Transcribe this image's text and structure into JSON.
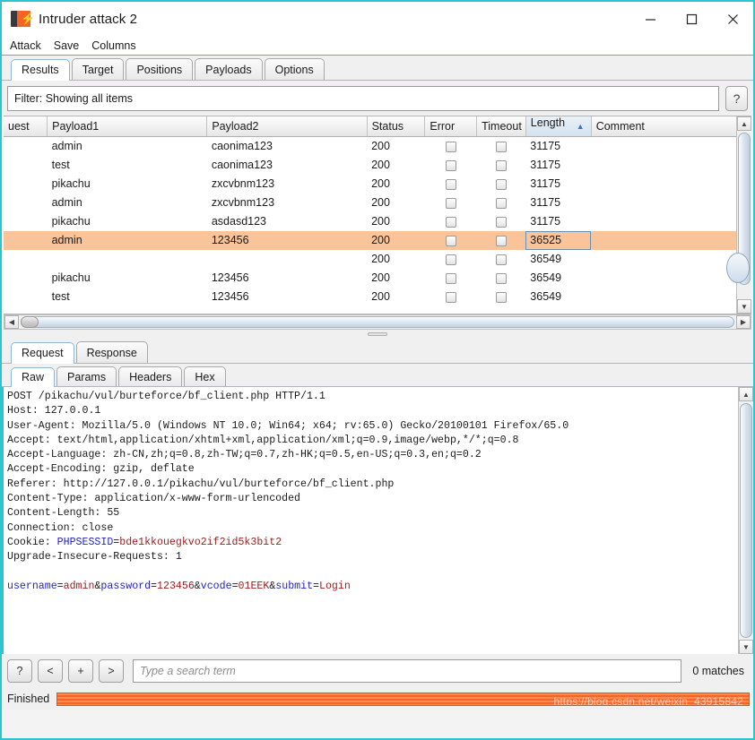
{
  "window": {
    "title": "Intruder attack 2",
    "icon": "burp-suite-icon",
    "minimize": "—",
    "maximize": "□",
    "close": "✕"
  },
  "menubar": {
    "items": [
      {
        "label": "Attack"
      },
      {
        "label": "Save"
      },
      {
        "label": "Columns"
      }
    ]
  },
  "main_tabs": [
    {
      "label": "Results",
      "active": true
    },
    {
      "label": "Target",
      "active": false
    },
    {
      "label": "Positions",
      "active": false
    },
    {
      "label": "Payloads",
      "active": false
    },
    {
      "label": "Options",
      "active": false
    }
  ],
  "filter": {
    "text": "Filter: Showing all items",
    "help_label": "?"
  },
  "results_table": {
    "columns": [
      {
        "label": "uest",
        "sorted": false
      },
      {
        "label": "Payload1",
        "sorted": false
      },
      {
        "label": "Payload2",
        "sorted": false
      },
      {
        "label": "Status",
        "sorted": false
      },
      {
        "label": "Error",
        "sorted": false
      },
      {
        "label": "Timeout",
        "sorted": false
      },
      {
        "label": "Length",
        "sorted": true
      },
      {
        "label": "Comment",
        "sorted": false
      }
    ],
    "sort_arrow": "▲",
    "rows": [
      {
        "request": "",
        "payload1": "admin",
        "payload2": "caonima123",
        "status": "200",
        "error": false,
        "timeout": false,
        "length": "31175",
        "comment": "",
        "selected": false
      },
      {
        "request": "",
        "payload1": "test",
        "payload2": "caonima123",
        "status": "200",
        "error": false,
        "timeout": false,
        "length": "31175",
        "comment": "",
        "selected": false
      },
      {
        "request": "",
        "payload1": "pikachu",
        "payload2": "zxcvbnm123",
        "status": "200",
        "error": false,
        "timeout": false,
        "length": "31175",
        "comment": "",
        "selected": false
      },
      {
        "request": "",
        "payload1": "admin",
        "payload2": "zxcvbnm123",
        "status": "200",
        "error": false,
        "timeout": false,
        "length": "31175",
        "comment": "",
        "selected": false
      },
      {
        "request": "",
        "payload1": "pikachu",
        "payload2": "asdasd123",
        "status": "200",
        "error": false,
        "timeout": false,
        "length": "31175",
        "comment": "",
        "selected": false
      },
      {
        "request": "",
        "payload1": "admin",
        "payload2": "123456",
        "status": "200",
        "error": false,
        "timeout": false,
        "length": "36525",
        "comment": "",
        "selected": true
      },
      {
        "request": "",
        "payload1": "",
        "payload2": "",
        "status": "200",
        "error": false,
        "timeout": false,
        "length": "36549",
        "comment": "",
        "selected": false
      },
      {
        "request": "",
        "payload1": "pikachu",
        "payload2": "123456",
        "status": "200",
        "error": false,
        "timeout": false,
        "length": "36549",
        "comment": "",
        "selected": false
      },
      {
        "request": "",
        "payload1": "test",
        "payload2": "123456",
        "status": "200",
        "error": false,
        "timeout": false,
        "length": "36549",
        "comment": "",
        "selected": false
      }
    ]
  },
  "message_tabs": [
    {
      "label": "Request",
      "active": true
    },
    {
      "label": "Response",
      "active": false
    }
  ],
  "view_tabs": [
    {
      "label": "Raw",
      "active": true
    },
    {
      "label": "Params",
      "active": false
    },
    {
      "label": "Headers",
      "active": false
    },
    {
      "label": "Hex",
      "active": false
    }
  ],
  "request": {
    "lines": [
      "POST /pikachu/vul/burteforce/bf_client.php HTTP/1.1",
      "Host: 127.0.0.1",
      "User-Agent: Mozilla/5.0 (Windows NT 10.0; Win64; x64; rv:65.0) Gecko/20100101 Firefox/65.0",
      "Accept: text/html,application/xhtml+xml,application/xml;q=0.9,image/webp,*/*;q=0.8",
      "Accept-Language: zh-CN,zh;q=0.8,zh-TW;q=0.7,zh-HK;q=0.5,en-US;q=0.3,en;q=0.2",
      "Accept-Encoding: gzip, deflate",
      "Referer: http://127.0.0.1/pikachu/vul/burteforce/bf_client.php",
      "Content-Type: application/x-www-form-urlencoded",
      "Content-Length: 55",
      "Connection: close"
    ],
    "cookie_label": "Cookie: ",
    "cookie_name": "PHPSESSID",
    "cookie_value": "bde1kkouegkvo2if2id5k3bit2",
    "upgrade_line": "Upgrade-Insecure-Requests: 1",
    "body_params": [
      {
        "name": "username",
        "value": "admin"
      },
      {
        "name": "password",
        "value": "123456"
      },
      {
        "name": "vcode",
        "value": "01EEK"
      },
      {
        "name": "submit",
        "value": "Login"
      }
    ]
  },
  "search_bar": {
    "help": "?",
    "prev": "<",
    "add": "+",
    "next": ">",
    "placeholder": "Type a search term",
    "value": "",
    "matches": "0 matches"
  },
  "status_bar": {
    "text": "Finished",
    "progress_percent": 100,
    "watermark": "https://blog.csdn.net/weixin_43915842"
  },
  "colors": {
    "window_border": "#2bc4cf",
    "selection": "#f9c49a",
    "progress": "#f4652a",
    "param_name": "#2222cc",
    "param_value": "#9c1b1b",
    "sort_arrow": "#3a77b5"
  }
}
